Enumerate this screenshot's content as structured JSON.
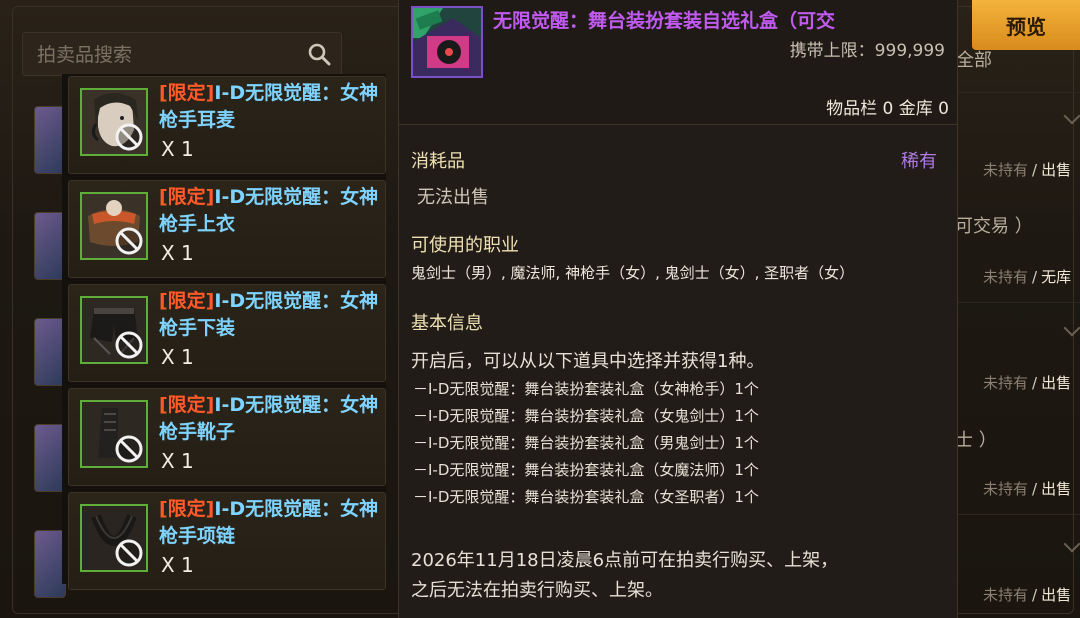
{
  "search": {
    "placeholder": "拍卖品搜索"
  },
  "preview_button": "预览",
  "category_all": "全部",
  "bg_status_rows": [
    {
      "a": "未持有",
      "b": "出售"
    },
    {
      "a": "未持有",
      "b": "无库"
    },
    {
      "a": "未持有",
      "b": "出售"
    },
    {
      "a": "未持有",
      "b": "出售"
    },
    {
      "a": "未持有",
      "b": "出售"
    }
  ],
  "bg_fragments": {
    "tradable": "可交易 ）",
    "job_frag": "士 ）"
  },
  "rewards": [
    {
      "tag": "[限定]",
      "name": "I-D无限觉醒：女神枪手耳麦",
      "qty": "X 1"
    },
    {
      "tag": "[限定]",
      "name": "I-D无限觉醒：女神枪手上衣",
      "qty": "X 1"
    },
    {
      "tag": "[限定]",
      "name": "I-D无限觉醒：女神枪手下装",
      "qty": "X 1"
    },
    {
      "tag": "[限定]",
      "name": "I-D无限觉醒：女神枪手靴子",
      "qty": "X 1"
    },
    {
      "tag": "[限定]",
      "name": "I-D无限觉醒：女神枪手项链",
      "qty": "X 1"
    }
  ],
  "tooltip": {
    "title": "无限觉醒：舞台装扮套装自选礼盒（可交",
    "carry_limit": "携带上限：999,999",
    "storage": "物品栏 0 金库 0",
    "type": "消耗品",
    "rarity": "稀有",
    "sell": "无法出售",
    "jobs_header": "可使用的职业",
    "jobs": "鬼剑士（男）, 魔法师, 神枪手（女）, 鬼剑士（女）, 圣职者（女）",
    "basic_header": "基本信息",
    "desc": "开启后，可以从以下道具中选择并获得1种。",
    "options": [
      "－I-D无限觉醒：舞台装扮套装礼盒（女神枪手）1个",
      "－I-D无限觉醒：舞台装扮套装礼盒（女鬼剑士）1个",
      "－I-D无限觉醒：舞台装扮套装礼盒（男鬼剑士）1个",
      "－I-D无限觉醒：舞台装扮套装礼盒（女魔法师）1个",
      "－I-D无限觉醒：舞台装扮套装礼盒（女圣职者）1个"
    ],
    "note_line1": "2026年11月18日凌晨6点前可在拍卖行购买、上架，",
    "note_line2": "之后无法在拍卖行购买、上架。"
  },
  "colors": {
    "limited_tag": "#ff5a2a",
    "item_name": "#7fd4ff",
    "title_purple": "#c15af0",
    "rarity_purple": "#b07ae6",
    "slot_green": "#5fae3c",
    "preview_orange": "#e8a02a"
  }
}
